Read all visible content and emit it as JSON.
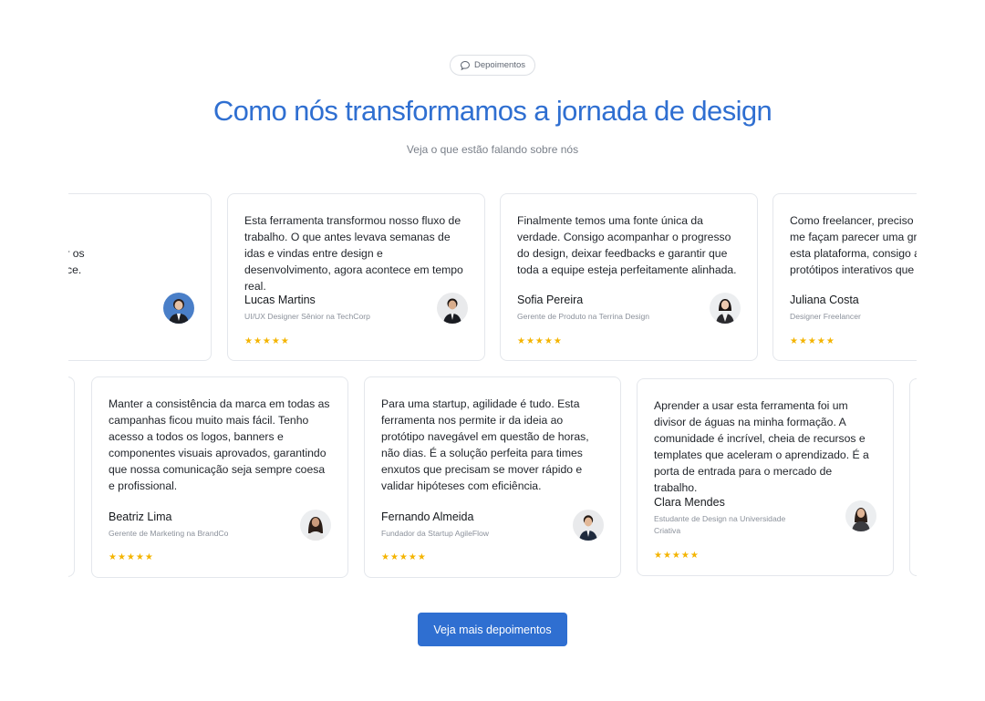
{
  "header": {
    "badge_label": "Depoimentos",
    "title": "Como nós transformamos a jornada de design",
    "subtitle": "Veja o que estão falando sobre nós"
  },
  "stars": "★★★★★",
  "row1": [
    {
      "quote": "n deixou de ser um\nnspecionar\nortar assets e pegar os\netamente da interface.",
      "name": "",
      "role": "",
      "stars": ""
    },
    {
      "quote": "Esta ferramenta transformou nosso fluxo de trabalho. O que antes levava semanas de idas e vindas entre design e desenvolvimento, agora acontece em tempo real.",
      "name": "Lucas Martins",
      "role": "UI/UX Designer Sênior na TechCorp",
      "stars": "★★★★★"
    },
    {
      "quote": "Finalmente temos uma fonte única da verdade. Consigo acompanhar o progresso do design, deixar feedbacks e garantir que toda a equipe esteja perfeitamente alinhada.",
      "name": "Sofia Pereira",
      "role": "Gerente de Produto na Terrina Design",
      "stars": "★★★★★"
    },
    {
      "quote": "Como freelancer, preciso c\nme façam parecer uma gra\nesta plataforma, consigo a\nprotótipos interativos que",
      "name": "Juliana Costa",
      "role": "Designer Freelancer",
      "stars": "★★★★★"
    }
  ],
  "row2": [
    {
      "quote": "Manter a consistência da marca em todas as campanhas ficou muito mais fácil. Tenho acesso a todos os logos, banners e componentes visuais aprovados, garantindo que nossa comunicação seja sempre coesa e profissional.",
      "name": "Beatriz Lima",
      "role": "Gerente de Marketing na BrandCo",
      "stars": "★★★★★"
    },
    {
      "quote": "Para uma startup, agilidade é tudo. Esta ferramenta nos permite ir da ideia ao protótipo navegável em questão de horas, não dias. É a solução perfeita para times enxutos que precisam se mover rápido e validar hipóteses com eficiência.",
      "name": "Fernando Almeida",
      "role": "Fundador da Startup AgileFlow",
      "stars": "★★★★★"
    },
    {
      "quote": "Aprender a usar esta ferramenta foi um divisor de águas na minha formação. A comunidade é incrível, cheia de recursos e templates que aceleram o aprendizado. É a porta de entrada para o mercado de trabalho.",
      "name": "Clara Mendes",
      "role": "Estudante de Design na Universidade Criativa",
      "stars": "★★★★★"
    }
  ],
  "cta": {
    "label": "Veja mais depoimentos"
  },
  "colors": {
    "accent": "#2f6fd1",
    "star": "#f4b400"
  }
}
